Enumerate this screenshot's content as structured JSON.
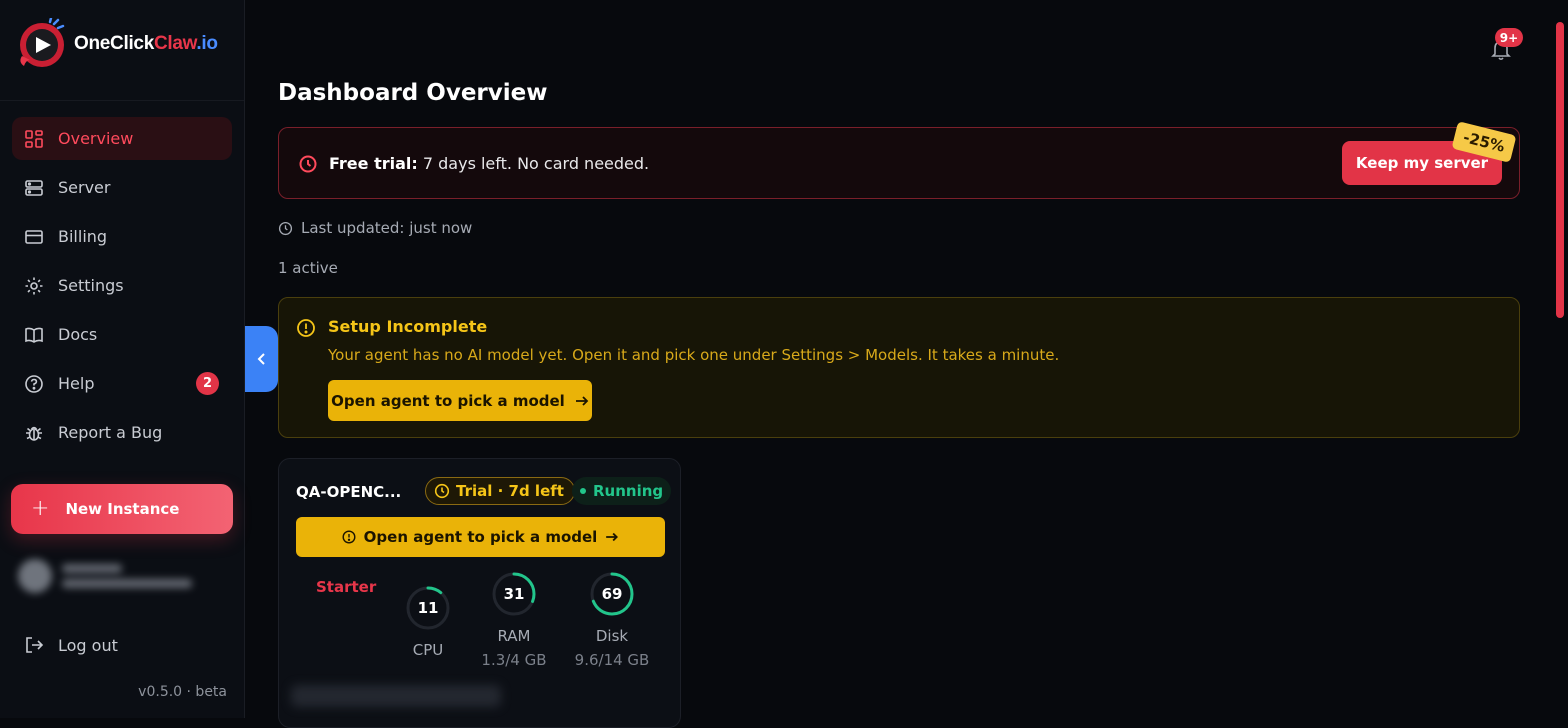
{
  "brand": {
    "name_part1": "OneClick",
    "name_part2": "Claw",
    "name_part3": ".io"
  },
  "sidebar": {
    "items": [
      {
        "label": "Overview",
        "icon": "grid-icon",
        "active": true
      },
      {
        "label": "Server",
        "icon": "server-icon"
      },
      {
        "label": "Billing",
        "icon": "card-icon"
      },
      {
        "label": "Settings",
        "icon": "gear-icon"
      },
      {
        "label": "Docs",
        "icon": "book-icon"
      },
      {
        "label": "Help",
        "icon": "help-icon",
        "badge": "2"
      },
      {
        "label": "Report a Bug",
        "icon": "bug-icon"
      }
    ],
    "new_instance": "New Instance",
    "logout": "Log out",
    "version": "v0.5.0 · beta"
  },
  "notifications": {
    "badge": "9+"
  },
  "page": {
    "title": "Dashboard Overview"
  },
  "trial_banner": {
    "label": "Free trial:",
    "text": " 7 days left. No card needed.",
    "button": "Keep my server",
    "discount": "-25%"
  },
  "status": {
    "last_updated": "Last updated: just now",
    "active_count": "1 active"
  },
  "setup": {
    "title": "Setup Incomplete",
    "description": "Your agent has no AI model yet. Open it and pick one under Settings > Models. It takes a minute.",
    "button": "Open agent to pick a model"
  },
  "instance": {
    "name": "QA-OPENC...",
    "trial": "Trial · 7d left",
    "status": "Running",
    "button": "Open agent to pick a model",
    "plan": "Starter",
    "gauges": [
      {
        "label": "CPU",
        "value": "11",
        "percent": 11,
        "sub": ""
      },
      {
        "label": "RAM",
        "value": "31",
        "percent": 31,
        "sub": "1.3/4 GB"
      },
      {
        "label": "Disk",
        "value": "69",
        "percent": 69,
        "sub": "9.6/14 GB"
      }
    ]
  },
  "colors": {
    "accent": "#e8364a",
    "warning": "#eab308",
    "success": "#22c58b",
    "link": "#3b82f6"
  }
}
